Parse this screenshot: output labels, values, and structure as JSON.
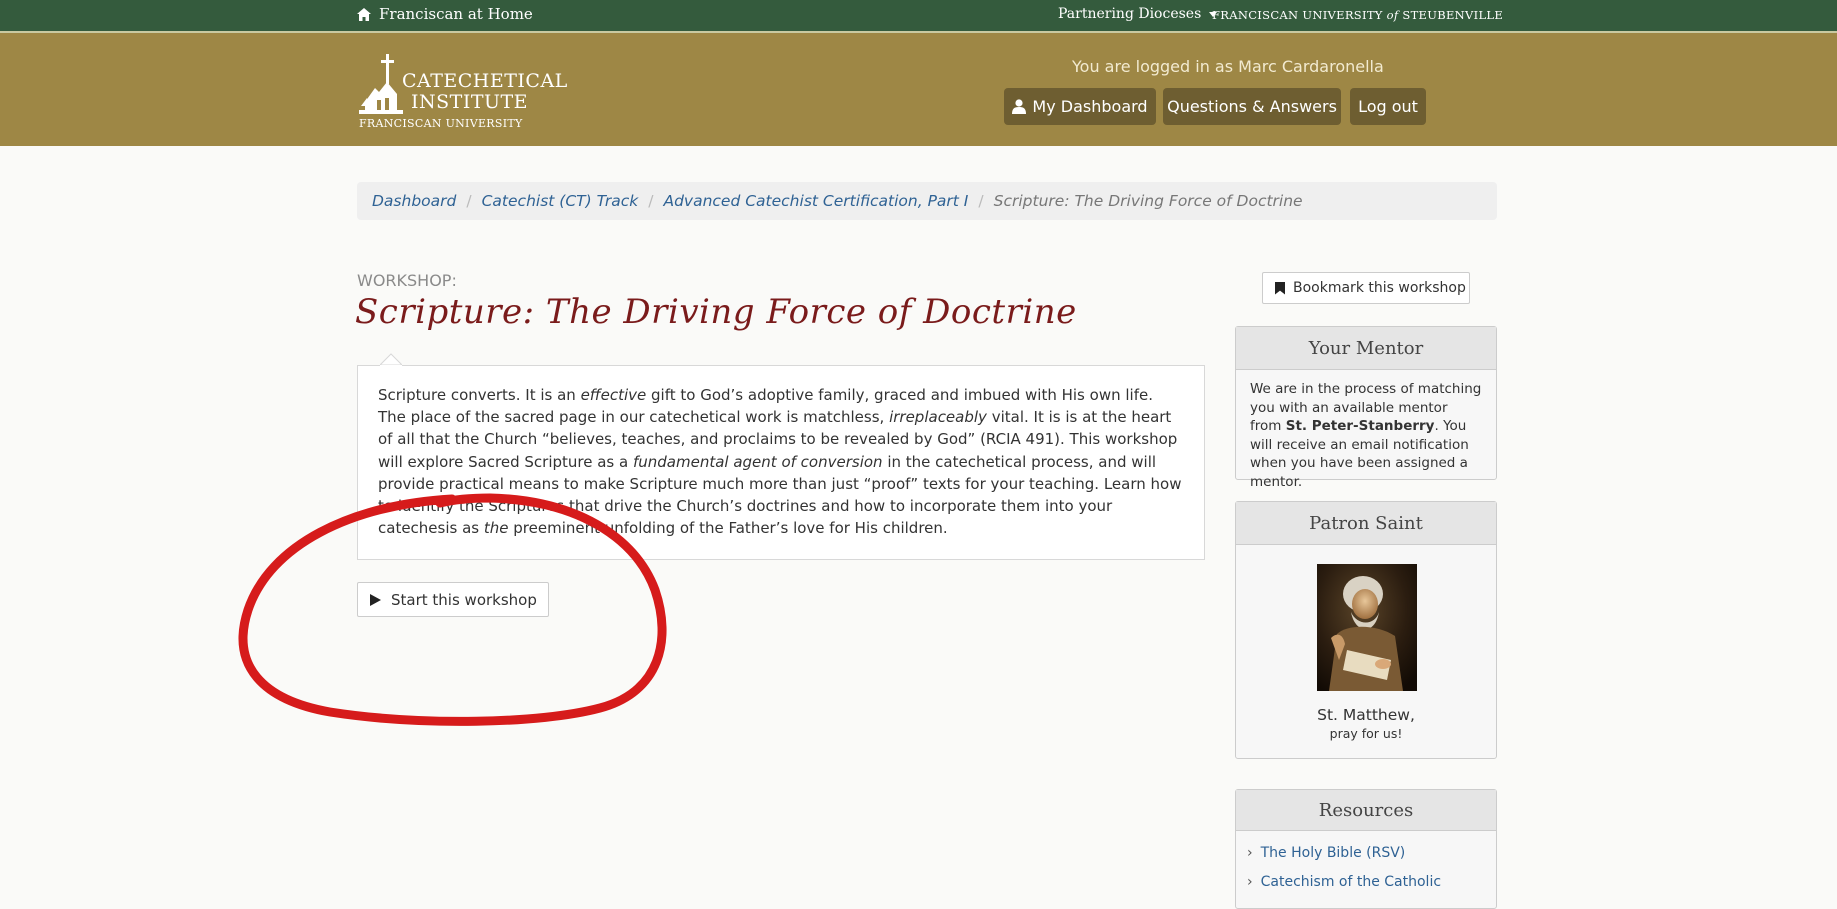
{
  "topbar": {
    "home_label": "Franciscan at Home",
    "dioceses_label": "Partnering Dioceses",
    "university_prefix": "FRANCISCAN UNIVERSITY",
    "university_of": "of",
    "university_suffix": "STEUBENVILLE"
  },
  "logo": {
    "line1": "CATECHETICAL",
    "line2": "INSTITUTE",
    "line3": "FRANCISCAN UNIVERSITY"
  },
  "header": {
    "logged_in_text": "You are logged in as Marc Cardaronella",
    "dashboard_label": "My Dashboard",
    "qa_label": "Questions & Answers",
    "logout_label": "Log out"
  },
  "breadcrumb": {
    "items": [
      "Dashboard",
      "Catechist (CT) Track",
      "Advanced Catechist Certification, Part I"
    ],
    "current": "Scripture: The Driving Force of Doctrine"
  },
  "workshop": {
    "kicker": "WORKSHOP:",
    "title": "Scripture: The Driving Force of Doctrine",
    "description": {
      "s1": "Scripture converts.  It is an ",
      "e1": "effective",
      "s2": " gift to God’s adoptive family, graced and imbued with His own life.  The place of the sacred page in our catechetical work is matchless, ",
      "e2": "irreplaceably",
      "s3": " vital.  It is is at the heart of all that the Church “believes, teaches, and proclaims to be revealed by God” (RCIA 491).  This workshop will explore Sacred Scripture as a ",
      "e3": "fundamental agent of conversion",
      "s4": " in the catechetical process, and will provide practical means to make Scripture much more than just “proof” texts for your teaching.  Learn how to identify the Scriptures that drive the Church’s doctrines and how to incorporate them into your catechesis as ",
      "e4": "the",
      "s5": " preeminent unfolding of the Father’s love for His children."
    },
    "start_label": "Start this workshop"
  },
  "sidebar": {
    "bookmark_label": "Bookmark this workshop",
    "mentor": {
      "title": "Your Mentor",
      "text1": "We are in the process of matching you with an available mentor from ",
      "parish": "St. Peter-Stanberry",
      "text2": ". You will receive an email notification when you have been assigned a mentor."
    },
    "saint": {
      "title": "Patron Saint",
      "name": "St. Matthew,",
      "pray": "pray for us!"
    },
    "resources": {
      "title": "Resources",
      "items": [
        "The Holy Bible (RSV)",
        "Catechism of the Catholic"
      ]
    }
  },
  "colors": {
    "topbar": "#345b3d",
    "header": "#9e8745",
    "header_button": "#6e5e31",
    "title": "#7a1b1b",
    "link": "#2f6294",
    "annotation": "#d61b1b"
  }
}
